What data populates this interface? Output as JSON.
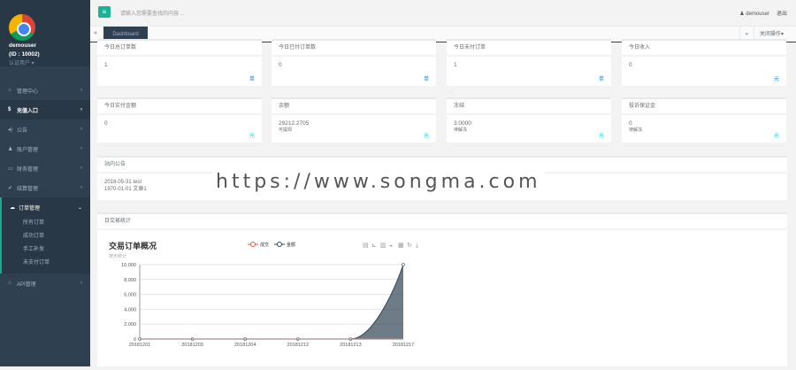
{
  "user": {
    "name": "demouser",
    "id": "(ID : 10002)",
    "role": "认证用户 ▾"
  },
  "sidebar": {
    "items": [
      {
        "icon": "home-icon",
        "glyph": "⌂",
        "label": "管理中心"
      },
      {
        "icon": "dollar-icon",
        "glyph": "$",
        "label": "充值入口"
      },
      {
        "icon": "volume-icon",
        "glyph": "◂)",
        "label": "公告"
      },
      {
        "icon": "user-icon",
        "glyph": "♟",
        "label": "账户管理"
      },
      {
        "icon": "card-icon",
        "glyph": "▭",
        "label": "财务管理"
      },
      {
        "icon": "check-icon",
        "glyph": "✔",
        "label": "结算管理"
      },
      {
        "icon": "cloud-icon",
        "glyph": "☁",
        "label": "订单管理"
      }
    ],
    "sub": [
      "所有订单",
      "成功订单",
      "手工补发",
      "未支付订单"
    ],
    "api": {
      "icon": "bank-icon",
      "glyph": "🏛",
      "label": "API管理"
    }
  },
  "top": {
    "search_placeholder": "请输入您需要查找的内容 ...",
    "user": "demouser",
    "logout": "退出"
  },
  "tabs": {
    "active": "Dashboard",
    "close_ops": "关闭操作▾"
  },
  "stats": [
    {
      "title": "今日总订单数",
      "value": "1",
      "unit": "单"
    },
    {
      "title": "今日已付订单数",
      "value": "0",
      "unit": "单"
    },
    {
      "title": "今日未付订单",
      "value": "1",
      "unit": "单"
    },
    {
      "title": "今日收入",
      "value": "0",
      "unit": "元"
    },
    {
      "title": "今日实付金额",
      "value": "0",
      "unit": "元",
      "note": ""
    },
    {
      "title": "余额",
      "value": "29212.2705",
      "unit": "元",
      "note": "可提现"
    },
    {
      "title": "冻结",
      "value": "3.0000",
      "unit": "元",
      "note": "待解冻"
    },
    {
      "title": "投诉保证金",
      "value": "0",
      "unit": "元",
      "note": "待解冻"
    }
  ],
  "notice": {
    "title": "站内公告",
    "items": [
      "2018-05-31 test",
      "1970-01-01 文章1"
    ]
  },
  "watermark": "https://www.songma.com",
  "daily": {
    "title": "日交易统计"
  },
  "chart_data": {
    "type": "area",
    "title": "交易订单概况",
    "subtitle": "按天统计",
    "categories": [
      "20181201",
      "20181203",
      "20181204",
      "20181212",
      "20181213",
      "20181217"
    ],
    "series": [
      {
        "name": "成交",
        "color": "#e05a4e",
        "values": [
          0,
          0,
          0,
          0,
          0,
          0
        ]
      },
      {
        "name": "金额",
        "color": "#2f4554",
        "values": [
          0,
          0,
          0,
          0,
          0,
          10000
        ]
      }
    ],
    "yticks": [
      "0",
      "2,000",
      "4,000",
      "6,000",
      "8,000",
      "10,000"
    ],
    "ylim": [
      0,
      10000
    ],
    "legend": "top-center"
  }
}
